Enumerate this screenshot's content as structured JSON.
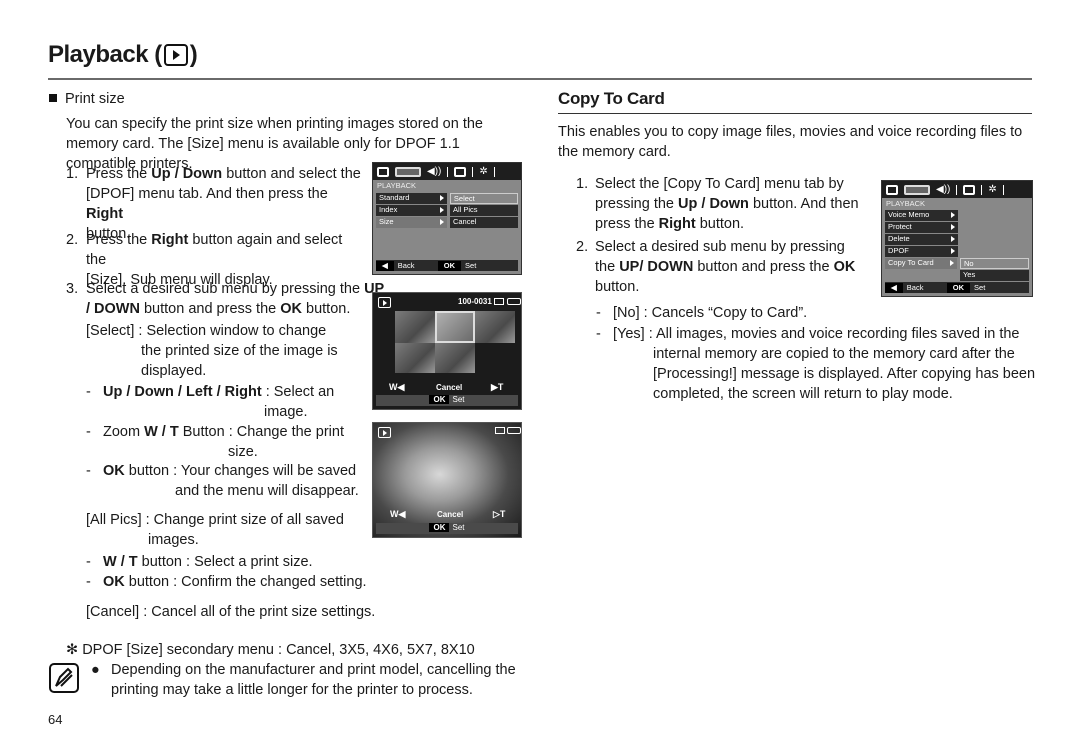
{
  "header": {
    "title": "Playback (",
    "title_end": ")",
    "icon": "play-icon"
  },
  "left": {
    "section_title": "Print size",
    "intro": "You can specify the print size when printing images stored on the memory card. The [Size] menu is available only for DPOF 1.1 compatible printers.",
    "step1": {
      "num": "1.",
      "a": "Press the ",
      "b1": "Up / Down",
      "c": " button and select the",
      "d": "[DPOF] menu tab. And then press the ",
      "b2": "Right",
      "e": "button."
    },
    "step2": {
      "num": "2.",
      "a": "Press the ",
      "b1": "Right",
      "c": " button again and select the",
      "d": "[Size]. Sub menu will display."
    },
    "step3": {
      "num": "3.",
      "a": "Select a desired sub menu by pressing the ",
      "b1": "UP",
      "b2": "/ DOWN",
      "c": " button and press the ",
      "b3": "OK",
      "d": " button."
    },
    "select": {
      "label": "[Select] : Selection window to change",
      "l2": "the printed size of the image is",
      "l3": "displayed."
    },
    "select_items": [
      {
        "bold": "Up / Down / Left / Right",
        "text": " : Select an",
        "cont": "image."
      },
      {
        "pre": "Zoom ",
        "bold": "W / T",
        "text": " Button : Change the print",
        "cont": "size."
      },
      {
        "bold": "OK",
        "text": " button : Your changes will be saved",
        "cont": "and the menu will disappear."
      }
    ],
    "allpics": {
      "label": "[All Pics] : Change print size of all saved",
      "l2": "images."
    },
    "allpics_items": [
      {
        "bold": "W / T",
        "text": " button : Select a print size."
      },
      {
        "bold": "OK",
        "text": " button : Confirm the changed setting."
      }
    ],
    "cancel": "[Cancel] : Cancel all of the print size settings.",
    "footnote": "DPOF [Size] secondary menu : Cancel, 3X5, 4X6, 5X7, 8X10",
    "note_l1": "Depending on the manufacturer and print model, cancelling the",
    "note_l2": "printing may take a little longer for the printer to process.",
    "page_number": "64"
  },
  "lcd_dpof": {
    "header": "PLAYBACK",
    "left_items": [
      "Standard",
      "Index",
      "Size"
    ],
    "right_items": [
      "Select",
      "All Pics",
      "Cancel"
    ],
    "back_key": "◀",
    "back": "Back",
    "ok_key": "OK",
    "set": "Set"
  },
  "lcd_index": {
    "file_number": "100-0031",
    "w_label": "W◀",
    "cancel": "Cancel",
    "t_label": "▶T",
    "ok_key": "OK",
    "set": "Set"
  },
  "lcd_photo": {
    "w_label": "W◀",
    "cancel": "Cancel",
    "t_label": "▷T",
    "ok_key": "OK",
    "set": "Set"
  },
  "right": {
    "section_title": "Copy To Card",
    "intro": "This enables you to copy image files, movies and voice recording files to the memory card.",
    "step1": {
      "num": "1.",
      "a": "Select the [Copy To Card] menu tab by",
      "b": "pressing the ",
      "b1": "Up / Down",
      "c": " button. And then",
      "d": "press the ",
      "b2": "Right",
      "e": " button."
    },
    "step2": {
      "num": "2.",
      "a": "Select a desired sub menu by pressing",
      "b": "the ",
      "b1": "UP/ DOWN",
      "c": " button and press the ",
      "b2": "OK",
      "d": "button."
    },
    "no_item": {
      "label": "[No]",
      "text": " : Cancels “Copy to Card”."
    },
    "yes_item": {
      "label": "[Yes]",
      "l1": " : All images, movies and voice recording files saved in the",
      "l2": "internal memory are copied to the memory card after the",
      "l3": "[Processing!] message is displayed. After copying has been",
      "l4": "completed, the screen will return to play mode."
    }
  },
  "lcd_copy": {
    "header": "PLAYBACK",
    "left_items": [
      "Voice Memo",
      "Protect",
      "Delete",
      "DPOF",
      "Copy To Card"
    ],
    "right_items": [
      "No",
      "Yes"
    ],
    "back_key": "◀",
    "back": "Back",
    "ok_key": "OK",
    "set": "Set"
  }
}
